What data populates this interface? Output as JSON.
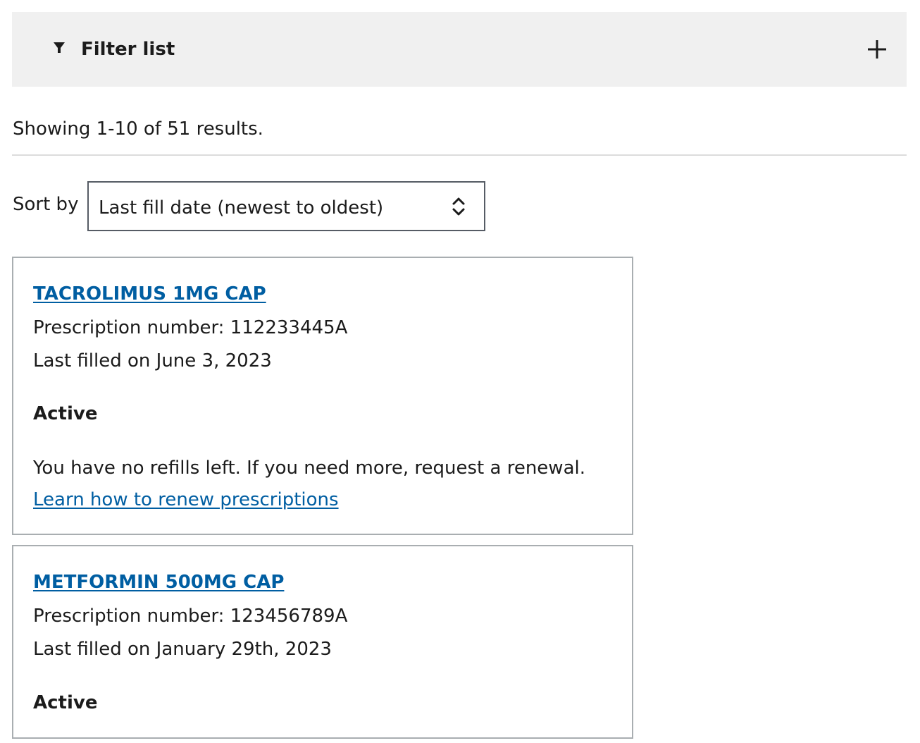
{
  "filter": {
    "title": "Filter list",
    "icon": "filter-icon",
    "expand_icon": "plus-icon"
  },
  "results": {
    "summary": "Showing 1-10 of 51 results."
  },
  "sort": {
    "label": "Sort by",
    "selected": "Last fill date (newest to oldest)",
    "icon": "updown-chevron-icon"
  },
  "prescriptions": [
    {
      "name": "TACROLIMUS 1MG CAP",
      "number_line": "Prescription number: 112233445A",
      "filled_line": "Last filled on June 3, 2023",
      "status": "Active",
      "message": "You have no refills left. If you need more, request a renewal.",
      "link_text": "Learn how to renew prescriptions"
    },
    {
      "name": "METFORMIN 500MG CAP",
      "number_line": "Prescription number: 123456789A",
      "filled_line": "Last filled on January 29th, 2023",
      "status": "Active"
    }
  ],
  "colors": {
    "link": "#005ea2",
    "filter_bg": "#f0f0f0",
    "card_border": "#a9aeb1"
  }
}
